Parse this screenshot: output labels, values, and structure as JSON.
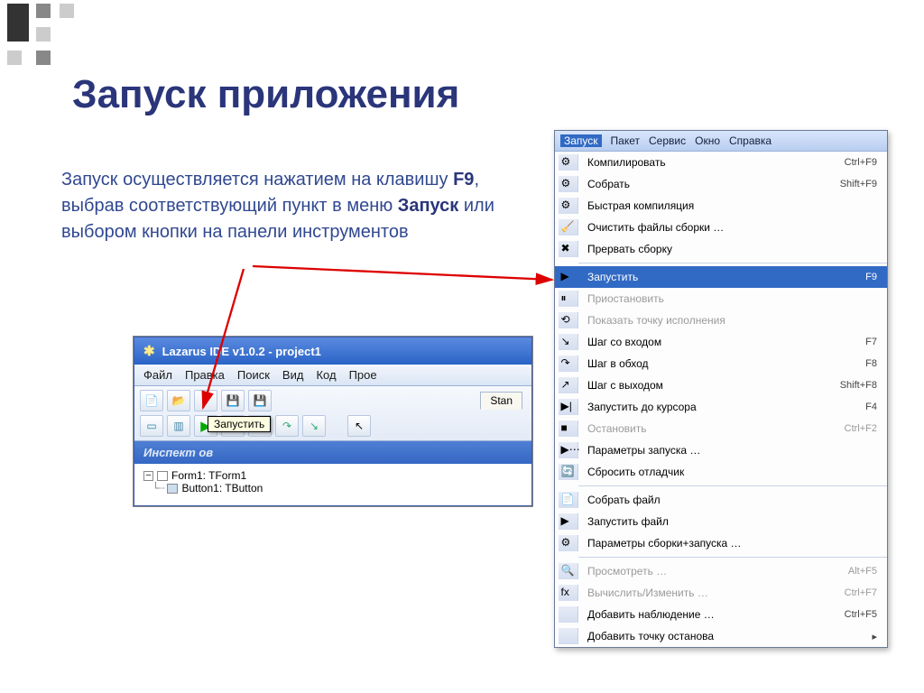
{
  "slide": {
    "title": "Запуск приложения",
    "body_pre": "Запуск осуществляется нажатием на клавишу ",
    "body_key": "F9",
    "body_mid": ", выбрав соответствующий пункт в меню ",
    "body_menu": "Запуск",
    "body_post": " или выбором кнопки на панели инструментов"
  },
  "lazarus": {
    "title": "Lazarus IDE v1.0.2 - project1",
    "menu": [
      "Файл",
      "Правка",
      "Поиск",
      "Вид",
      "Код",
      "Прое"
    ],
    "tab": "Stan",
    "tooltip": "Запустить",
    "inspector_title": "Инспект                     ов",
    "tree_form": "Form1: TForm1",
    "tree_button": "Button1: TButton"
  },
  "dropdown": {
    "top": [
      "Запуск",
      "Пакет",
      "Сервис",
      "Окно",
      "Справка"
    ],
    "top_selected": 0,
    "items": [
      {
        "icon": "⚙",
        "label": "Компилировать",
        "shortcut": "Ctrl+F9",
        "disabled": false
      },
      {
        "icon": "⚙",
        "label": "Собрать",
        "shortcut": "Shift+F9",
        "disabled": false
      },
      {
        "icon": "⚙",
        "label": "Быстрая компиляция",
        "shortcut": "",
        "disabled": false
      },
      {
        "icon": "🧹",
        "label": "Очистить файлы сборки …",
        "shortcut": "",
        "disabled": false
      },
      {
        "icon": "✖",
        "label": "Прервать сборку",
        "shortcut": "",
        "disabled": false
      },
      {
        "sep": true
      },
      {
        "icon": "▶",
        "label": "Запустить",
        "shortcut": "F9",
        "disabled": false,
        "highlight": true
      },
      {
        "icon": "⏸",
        "label": "Приостановить",
        "shortcut": "",
        "disabled": true
      },
      {
        "icon": "⟲",
        "label": "Показать точку исполнения",
        "shortcut": "",
        "disabled": true
      },
      {
        "icon": "↘",
        "label": "Шаг со входом",
        "shortcut": "F7",
        "disabled": false
      },
      {
        "icon": "↷",
        "label": "Шаг в обход",
        "shortcut": "F8",
        "disabled": false
      },
      {
        "icon": "↗",
        "label": "Шаг с выходом",
        "shortcut": "Shift+F8",
        "disabled": false
      },
      {
        "icon": "▶|",
        "label": "Запустить до курсора",
        "shortcut": "F4",
        "disabled": false
      },
      {
        "icon": "■",
        "label": "Остановить",
        "shortcut": "Ctrl+F2",
        "disabled": true
      },
      {
        "icon": "▶⋯",
        "label": "Параметры запуска …",
        "shortcut": "",
        "disabled": false
      },
      {
        "icon": "🔄",
        "label": "Сбросить отладчик",
        "shortcut": "",
        "disabled": false
      },
      {
        "sep": true
      },
      {
        "icon": "📄",
        "label": "Собрать файл",
        "shortcut": "",
        "disabled": false
      },
      {
        "icon": "▶",
        "label": "Запустить файл",
        "shortcut": "",
        "disabled": false
      },
      {
        "icon": "⚙",
        "label": "Параметры сборки+запуска …",
        "shortcut": "",
        "disabled": false
      },
      {
        "sep": true
      },
      {
        "icon": "🔍",
        "label": "Просмотреть …",
        "shortcut": "Alt+F5",
        "disabled": true
      },
      {
        "icon": "fx",
        "label": "Вычислить/Изменить …",
        "shortcut": "Ctrl+F7",
        "disabled": true
      },
      {
        "icon": "",
        "label": "Добавить наблюдение …",
        "shortcut": "Ctrl+F5",
        "disabled": false
      },
      {
        "icon": "",
        "label": "Добавить точку останова",
        "shortcut": "▸",
        "disabled": false
      }
    ]
  }
}
